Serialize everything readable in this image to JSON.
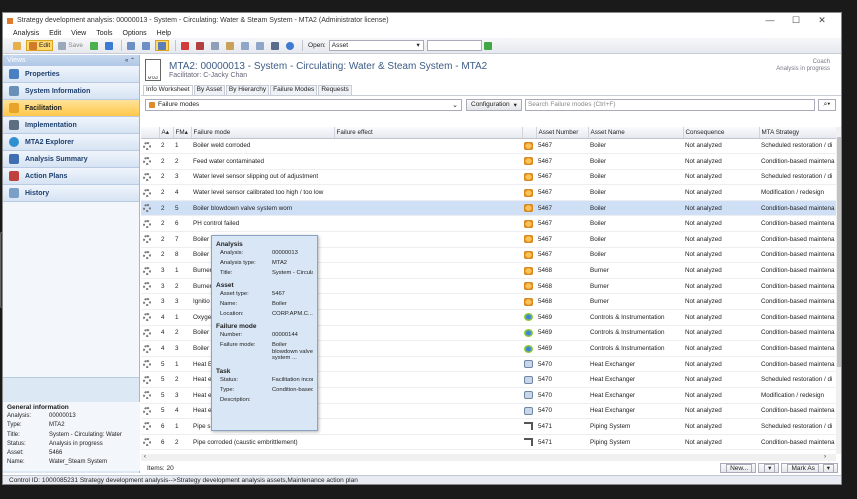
{
  "window": {
    "title": "Strategy development analysis: 00000013 - System - Circulating: Water & Steam System - MTA2 (Administrator license)",
    "controls": [
      "—",
      "☐",
      "✕"
    ]
  },
  "menu": [
    "Analysis",
    "Edit",
    "View",
    "Tools",
    "Options",
    "Help"
  ],
  "toolbar": {
    "edit_label": "Edit",
    "save_label": "Save",
    "open_label": "Open:",
    "open_value": "Asset"
  },
  "sidebar": {
    "header": "Views",
    "header_ctl": "« ⌃",
    "items": [
      {
        "label": "Properties",
        "color": "#4a7fc1"
      },
      {
        "label": "System Information",
        "color": "#6a8fb8"
      },
      {
        "label": "Facilitation",
        "color": "#e8a32a"
      },
      {
        "label": "Implementation",
        "color": "#5d6e82"
      },
      {
        "label": "MTA2 Explorer",
        "color": "#2f8fd0"
      },
      {
        "label": "Analysis Summary",
        "color": "#3f6fb0"
      },
      {
        "label": "Action Plans",
        "color": "#c04040"
      },
      {
        "label": "History",
        "color": "#7aa0c8"
      }
    ],
    "general_info": {
      "heading": "General information",
      "rows": [
        {
          "k": "Analysis:",
          "v": "00000013"
        },
        {
          "k": "Type:",
          "v": "MTA2"
        },
        {
          "k": "Title:",
          "v": "System - Circulating: Water"
        },
        {
          "k": "Status:",
          "v": "Analysis in progress"
        },
        {
          "k": "Asset:",
          "v": "5466"
        },
        {
          "k": "Name:",
          "v": "Water_Steam System"
        }
      ]
    }
  },
  "header": {
    "logo_text": "MTA2",
    "title": "MTA2: 00000013 - System - Circulating: Water & Steam System - MTA2",
    "subtitle": "Facilitator: C-Jacky Chan",
    "coach": "Coach",
    "coach_status": "Analysis in progress"
  },
  "tabs": [
    "Info Worksheet",
    "By Asset",
    "By Hierarchy",
    "Failure Modes",
    "Requests"
  ],
  "filter": {
    "selected": "Failure modes",
    "configuration": "Configuration",
    "search_placeholder": "Search Failure modes (Ctrl+F)"
  },
  "grid": {
    "columns": [
      "",
      "A",
      "FM",
      "Failure mode",
      "Failure effect",
      "",
      "Asset Number",
      "Asset Name",
      "Consequence",
      "MTA Strategy"
    ],
    "rows": [
      {
        "a": "2",
        "fm": "1",
        "mode": "Boiler weld corroded",
        "icon": "gear-o",
        "num": "5467",
        "name": "Boiler",
        "cons": "Not analyzed",
        "strat": "Scheduled restoration / di"
      },
      {
        "a": "2",
        "fm": "2",
        "mode": "Feed water contaminated",
        "icon": "gear-o",
        "num": "5467",
        "name": "Boiler",
        "cons": "Not analyzed",
        "strat": "Condition-based maintena"
      },
      {
        "a": "2",
        "fm": "3",
        "mode": "Water level sensor slipping out of adjustment",
        "icon": "gear-o",
        "num": "5467",
        "name": "Boiler",
        "cons": "Not analyzed",
        "strat": "Scheduled restoration / di"
      },
      {
        "a": "2",
        "fm": "4",
        "mode": "Water level sensor calibrated too high / too low",
        "icon": "gear-o",
        "num": "5467",
        "name": "Boiler",
        "cons": "Not analyzed",
        "strat": "Modification / redesign"
      },
      {
        "a": "2",
        "fm": "5",
        "mode": "Boiler blowdown valve system worn",
        "icon": "gear-o",
        "num": "5467",
        "name": "Boiler",
        "cons": "Not analyzed",
        "strat": "Condition-based maintena"
      },
      {
        "a": "2",
        "fm": "6",
        "mode": "PH control failed",
        "icon": "gear-o",
        "num": "5467",
        "name": "Boiler",
        "cons": "Not analyzed",
        "strat": "Condition-based maintena"
      },
      {
        "a": "2",
        "fm": "7",
        "mode": "Boiler w",
        "icon": "gear-o",
        "num": "5467",
        "name": "Boiler",
        "cons": "Not analyzed",
        "strat": "Condition-based maintena"
      },
      {
        "a": "2",
        "fm": "8",
        "mode": "Boiler s",
        "icon": "gear-o",
        "num": "5467",
        "name": "Boiler",
        "cons": "Not analyzed",
        "strat": "Condition-based maintena"
      },
      {
        "a": "3",
        "fm": "1",
        "mode": "Burner",
        "icon": "gear-o",
        "num": "5468",
        "name": "Burner",
        "cons": "Not analyzed",
        "strat": "Condition-based maintena"
      },
      {
        "a": "3",
        "fm": "2",
        "mode": "Burner",
        "icon": "gear-o",
        "num": "5468",
        "name": "Burner",
        "cons": "Not analyzed",
        "strat": "Condition-based maintena"
      },
      {
        "a": "3",
        "fm": "3",
        "mode": "Ignitio",
        "icon": "gear-o",
        "num": "5468",
        "name": "Burner",
        "cons": "Not analyzed",
        "strat": "Condition-based maintena"
      },
      {
        "a": "4",
        "fm": "1",
        "mode": "Oxyge",
        "icon": "fan",
        "num": "5469",
        "name": "Controls & Instrumentation",
        "cons": "Not analyzed",
        "strat": "Condition-based maintena"
      },
      {
        "a": "4",
        "fm": "2",
        "mode": "Boiler t",
        "icon": "fan",
        "num": "5469",
        "name": "Controls & Instrumentation",
        "cons": "Not analyzed",
        "strat": "Condition-based maintena"
      },
      {
        "a": "4",
        "fm": "3",
        "mode": "Boiler v",
        "icon": "fan",
        "num": "5469",
        "name": "Controls & Instrumentation",
        "cons": "Not analyzed",
        "strat": "Condition-based maintena"
      },
      {
        "a": "5",
        "fm": "1",
        "mode": "Heat E",
        "icon": "hx",
        "num": "5470",
        "name": "Heat Exchanger",
        "cons": "Not analyzed",
        "strat": "Condition-based maintena"
      },
      {
        "a": "5",
        "fm": "2",
        "mode": "Heat e",
        "icon": "hx",
        "num": "5470",
        "name": "Heat Exchanger",
        "cons": "Not analyzed",
        "strat": "Scheduled restoration / di"
      },
      {
        "a": "5",
        "fm": "3",
        "mode": "Heat e",
        "icon": "hx",
        "num": "5470",
        "name": "Heat Exchanger",
        "cons": "Not analyzed",
        "strat": "Modification / redesign"
      },
      {
        "a": "5",
        "fm": "4",
        "mode": "Heat e",
        "icon": "hx",
        "num": "5470",
        "name": "Heat Exchanger",
        "cons": "Not analyzed",
        "strat": "Condition-based maintena"
      },
      {
        "a": "6",
        "fm": "1",
        "mode": "Pipe s",
        "icon": "pipe",
        "num": "5471",
        "name": "Piping System",
        "cons": "Not analyzed",
        "strat": "Scheduled restoration / di"
      },
      {
        "a": "6",
        "fm": "2",
        "mode": "Pipe corroded (caustic embrittlement)",
        "icon": "pipe",
        "num": "5471",
        "name": "Piping System",
        "cons": "Not analyzed",
        "strat": "Condition-based maintena"
      }
    ],
    "selected_row": 4
  },
  "tooltip": {
    "sections": [
      {
        "title": "Analysis",
        "rows": [
          {
            "k": "Analysis:",
            "v": "00000013"
          },
          {
            "k": "Analysis type:",
            "v": "MTA2"
          },
          {
            "k": "Title:",
            "v": "System - Circulatin"
          }
        ]
      },
      {
        "title": "Asset",
        "rows": [
          {
            "k": "Asset type:",
            "v": "5467"
          },
          {
            "k": "Name:",
            "v": "Boiler"
          },
          {
            "k": "Location:",
            "v": "CORP.APM.C..."
          }
        ]
      },
      {
        "title": "Failure mode",
        "rows": [
          {
            "k": "Number:",
            "v": "00000144"
          },
          {
            "k": "Failure mode:",
            "v": "Boiler blowdown valve system ..."
          }
        ]
      },
      {
        "title": "Task",
        "rows": [
          {
            "k": "Status:",
            "v": "Facilitation incompl"
          },
          {
            "k": "Type:",
            "v": "Condition-based m"
          },
          {
            "k": "Description:",
            "v": ""
          }
        ]
      }
    ]
  },
  "footer": {
    "items_label": "Items: 20",
    "new_label": "New...",
    "mark_label": "Mark As"
  },
  "statusbar": "Control ID: 1000085231   Strategy development analysis-->Strategy development analysis assets,Maintenance action plan"
}
